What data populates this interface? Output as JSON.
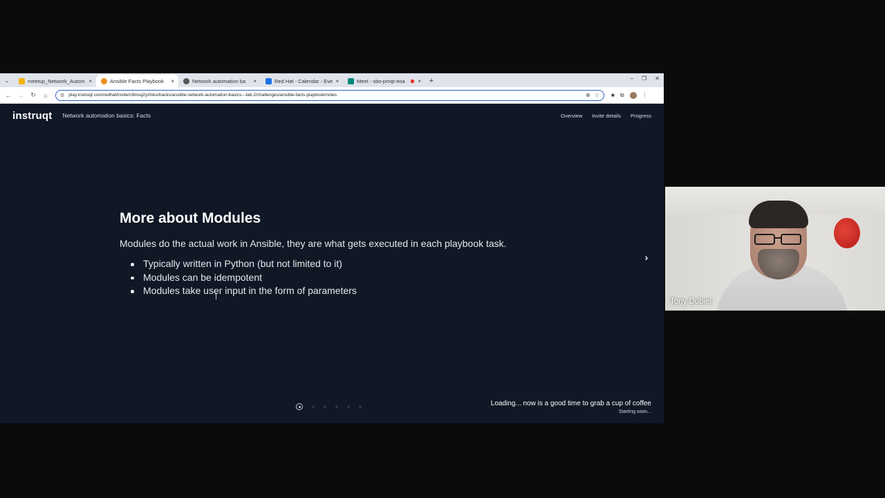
{
  "browser": {
    "tabs": [
      {
        "title": "meetup_Network_Autom",
        "favicon_color": "#f4b400",
        "active": false
      },
      {
        "title": "Ansible Facts Playbook",
        "favicon_color": "#f08c1a",
        "active": true
      },
      {
        "title": "Network automation ba",
        "favicon_color": "#555555",
        "active": false
      },
      {
        "title": "Red Hat - Calendar - Eve",
        "favicon_color": "#1a73e8",
        "active": false
      },
      {
        "title": "Meet - sbo-pmqt-eoa",
        "favicon_color": "#00897b",
        "active": false
      }
    ],
    "url": "play.instruqt.com/redhat/invite/c9mxq2yzlnks/tracks/ansible-network-automation-basics---lab-2/challenges/ansible-facts-playbook/notes"
  },
  "app": {
    "logo": "instruqt",
    "track_title": "Network automation basics: Facts",
    "nav": [
      "Overview",
      "Invite details",
      "Progress"
    ]
  },
  "slide": {
    "title": "More about Modules",
    "intro": "Modules do the actual work in Ansible, they are what gets executed in each playbook task.",
    "bullets": [
      "Typically written in Python (but not limited to it)",
      "Modules can be idempotent",
      "Modules take user input in the form of parameters"
    ],
    "current_dot": 1,
    "total_dots": 6
  },
  "status": {
    "loading": "Loading... now is a good time to grab a cup of coffee",
    "sub": "Starting soon..."
  },
  "webcam": {
    "participant_name": "Tony Dubiel"
  }
}
